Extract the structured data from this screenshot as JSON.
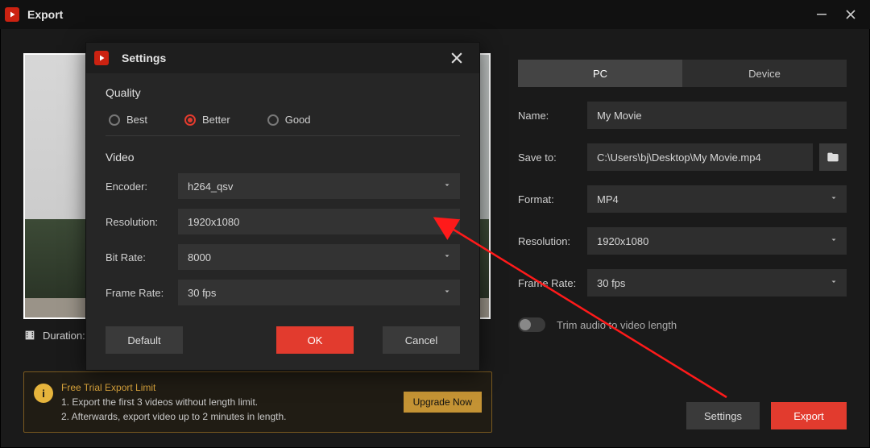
{
  "export": {
    "title": "Export",
    "duration_label": "Duration:",
    "tabs": {
      "pc": "PC",
      "device": "Device"
    },
    "name_label": "Name:",
    "name_value": "My Movie",
    "save_label": "Save to:",
    "save_value": "C:\\Users\\bj\\Desktop\\My Movie.mp4",
    "format_label": "Format:",
    "format_value": "MP4",
    "resolution_label": "Resolution:",
    "resolution_value": "1920x1080",
    "framerate_label": "Frame Rate:",
    "framerate_value": "30 fps",
    "trim_label": "Trim audio to video length",
    "settings_btn": "Settings",
    "export_btn": "Export"
  },
  "trial": {
    "title": "Free Trial Export Limit",
    "line1": "1. Export the first 3 videos without length limit.",
    "line2": "2. Afterwards, export video up to 2 minutes in length.",
    "upgrade": "Upgrade Now"
  },
  "settings": {
    "title": "Settings",
    "quality_section": "Quality",
    "quality_options": {
      "best": "Best",
      "better": "Better",
      "good": "Good"
    },
    "video_section": "Video",
    "encoder_label": "Encoder:",
    "encoder_value": "h264_qsv",
    "resolution_label": "Resolution:",
    "resolution_value": "1920x1080",
    "bitrate_label": "Bit Rate:",
    "bitrate_value": "8000",
    "framerate_label": "Frame Rate:",
    "framerate_value": "30 fps",
    "default_btn": "Default",
    "ok_btn": "OK",
    "cancel_btn": "Cancel"
  }
}
